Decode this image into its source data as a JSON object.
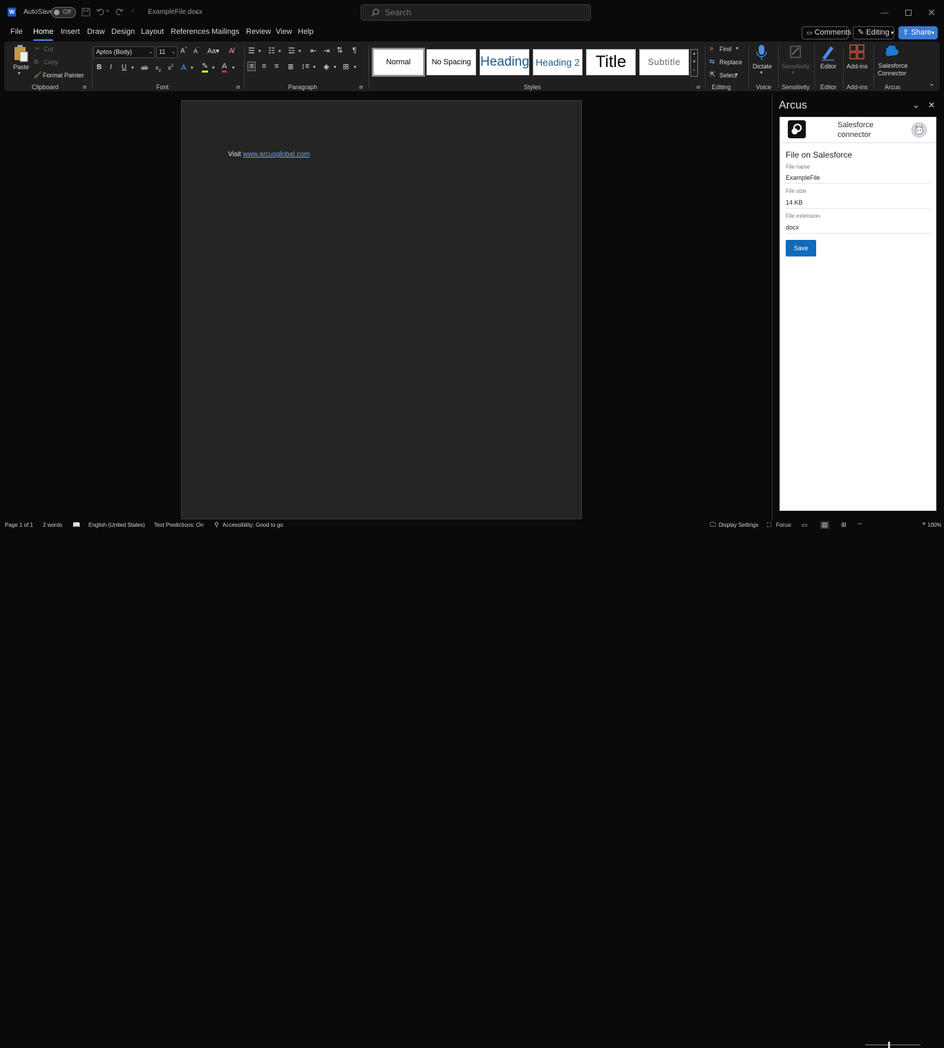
{
  "titlebar": {
    "app_icon": "word-icon",
    "autosave_label": "AutoSave",
    "autosave_state": "Off",
    "filename": "ExampleFile.docx",
    "search_placeholder": "Search"
  },
  "menu": {
    "items": [
      "File",
      "Home",
      "Insert",
      "Draw",
      "Design",
      "Layout",
      "References",
      "Mailings",
      "Review",
      "View",
      "Help"
    ],
    "active": "Home",
    "comments_label": "Comments",
    "editing_label": "Editing",
    "share_label": "Share"
  },
  "ribbon": {
    "clipboard": {
      "paste": "Paste",
      "cut": "Cut",
      "copy": "Copy",
      "format_painter": "Format Painter",
      "label": "Clipboard"
    },
    "font": {
      "name": "Aptos (Body)",
      "size": "11",
      "label": "Font"
    },
    "paragraph": {
      "label": "Paragraph"
    },
    "styles": {
      "items": [
        "Normal",
        "No Spacing",
        "Heading",
        "Heading 2",
        "Title",
        "Subtitle"
      ],
      "label": "Styles"
    },
    "editing": {
      "find": "Find",
      "replace": "Replace",
      "select": "Select",
      "label": "Editing"
    },
    "voice": {
      "dictate": "Dictate",
      "label": "Voice"
    },
    "sensitivity": {
      "button": "Sensitivity",
      "label": "Sensitivity"
    },
    "editor": {
      "button": "Editor",
      "label": "Editor"
    },
    "addins": {
      "button": "Add-ins",
      "label": "Add-ins"
    },
    "arcus": {
      "button_line1": "Salesforce",
      "button_line2": "Connector",
      "label": "Arcus"
    }
  },
  "document": {
    "visit_text": "Visit ",
    "link_text": "www.arcusglobal.com"
  },
  "pane": {
    "title": "Arcus",
    "connector_line1": "Salesforce",
    "connector_line2": "connector",
    "section_title": "File on Salesforce",
    "fields": [
      {
        "label": "File name",
        "value": "ExampleFile"
      },
      {
        "label": "File size",
        "value": "14 KB"
      },
      {
        "label": "File extension",
        "value": "docx"
      }
    ],
    "save_label": "Save"
  },
  "status": {
    "page": "Page 1 of 1",
    "words": "2 words",
    "language": "English (United States)",
    "predictions": "Text Predictions: On",
    "accessibility": "Accessibility: Good to go",
    "display_settings": "Display Settings",
    "focus": "Focus",
    "zoom": "100%"
  },
  "colors": {
    "accent": "#4f8fe8",
    "share_bg": "#3a7bd5",
    "save_bg": "#0f6cbd",
    "link": "#6ea8e6"
  }
}
